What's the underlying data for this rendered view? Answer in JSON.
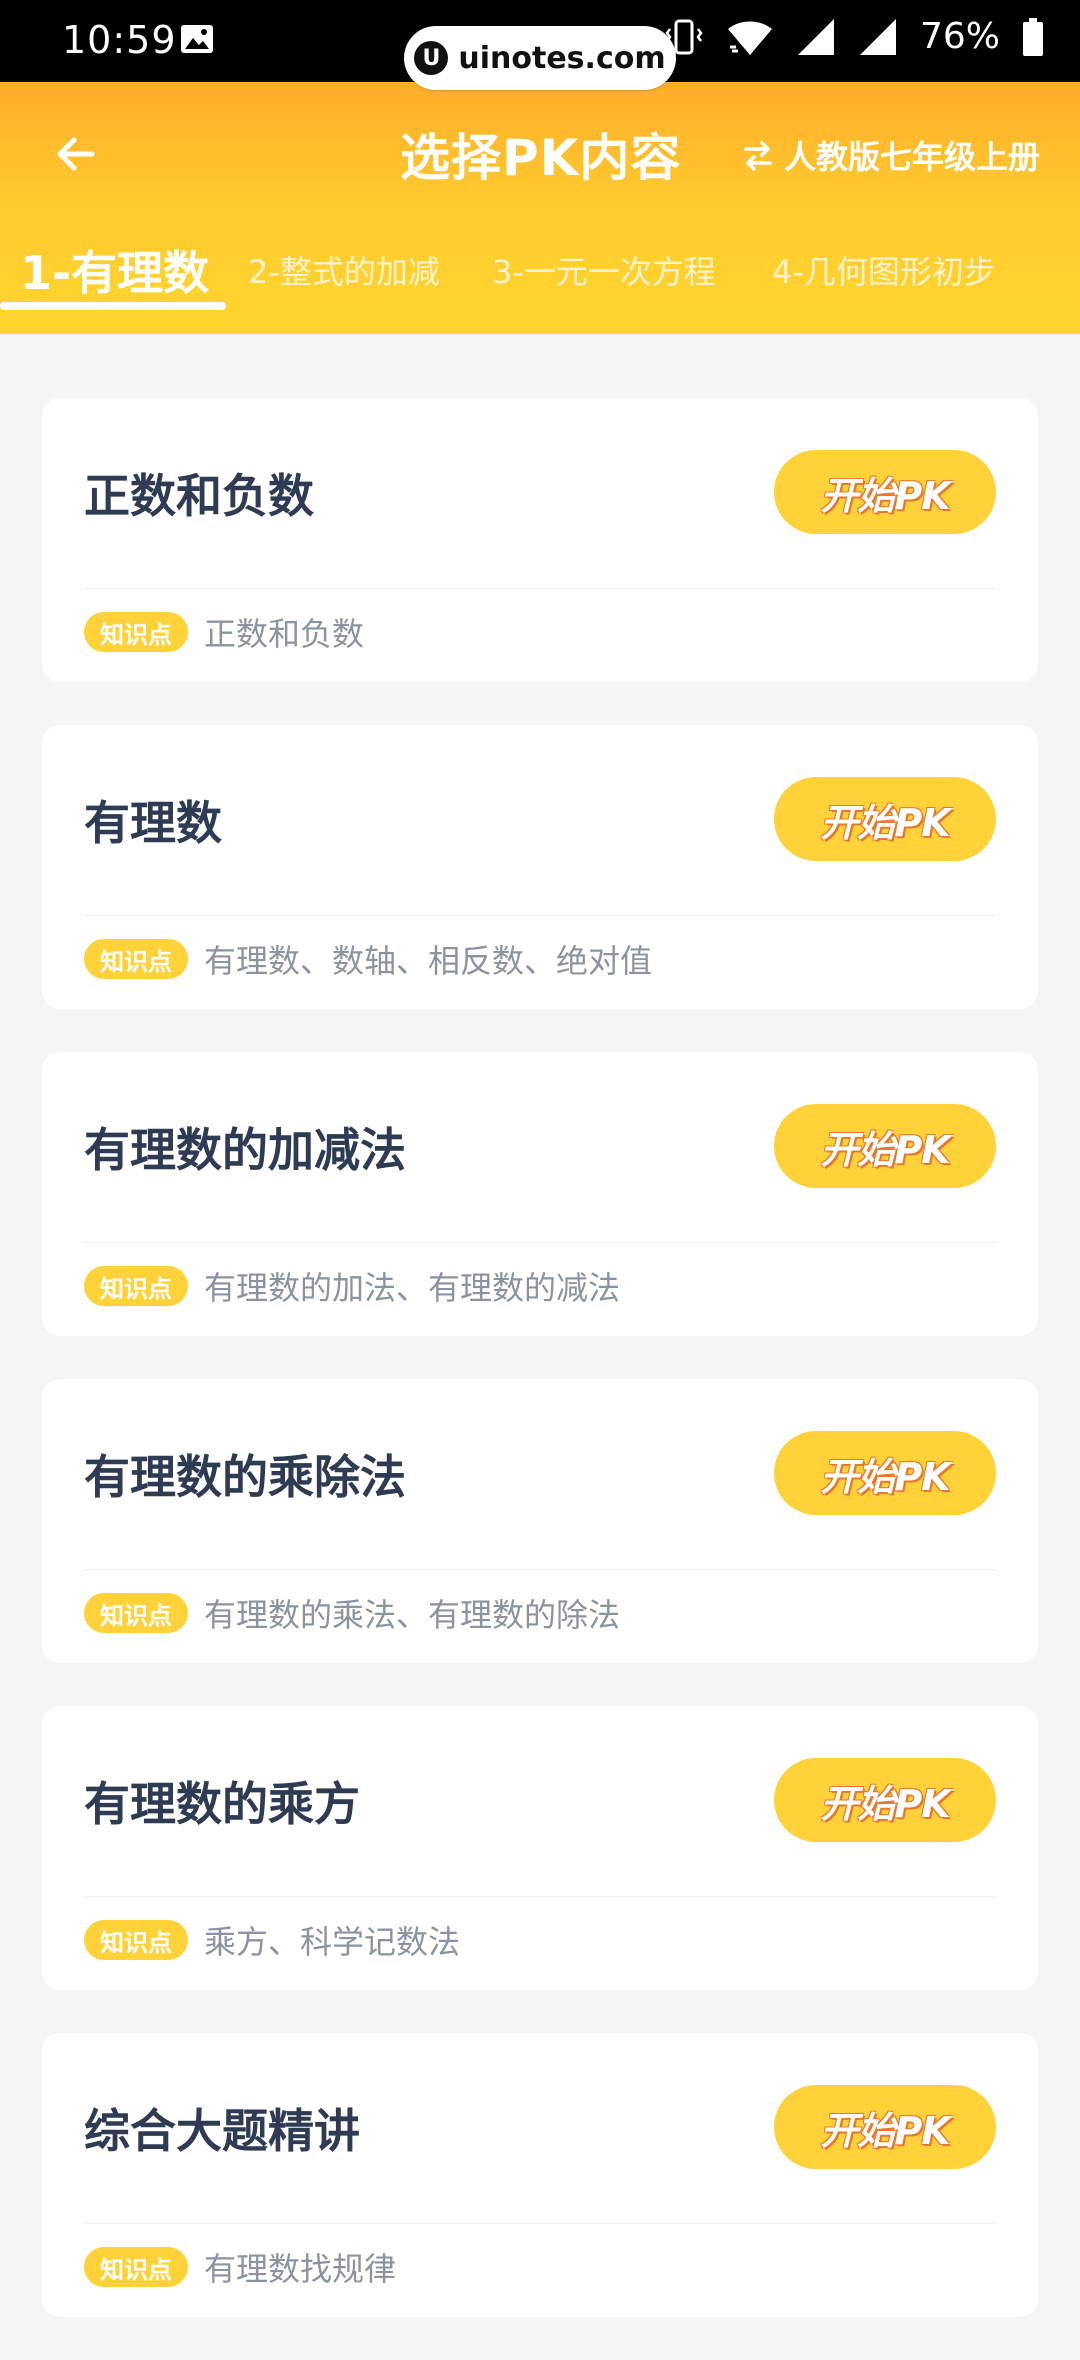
{
  "status_bar": {
    "time": "10:59",
    "battery": "76%",
    "icons": [
      "gallery-icon",
      "vibrate-icon",
      "wifi-icon",
      "signal-icon",
      "signal-icon",
      "battery-icon"
    ]
  },
  "watermark": {
    "text": "uinotes.com",
    "logo_letter": "U"
  },
  "header": {
    "title": "选择PK内容",
    "edition": "人教版七年级上册",
    "back_icon": "arrow-left-icon",
    "switch_icon": "swap-icon"
  },
  "tabs": [
    {
      "label": "1-有理数",
      "active": true
    },
    {
      "label": "2-整式的加减",
      "active": false
    },
    {
      "label": "3-一元一次方程",
      "active": false
    },
    {
      "label": "4-几何图形初步",
      "active": false
    }
  ],
  "cards": [
    {
      "title": "正数和负数",
      "button": "开始PK",
      "badge": "知识点",
      "points": "正数和负数"
    },
    {
      "title": "有理数",
      "button": "开始PK",
      "badge": "知识点",
      "points": "有理数、数轴、相反数、绝对值"
    },
    {
      "title": "有理数的加减法",
      "button": "开始PK",
      "badge": "知识点",
      "points": "有理数的加法、有理数的减法"
    },
    {
      "title": "有理数的乘除法",
      "button": "开始PK",
      "badge": "知识点",
      "points": "有理数的乘法、有理数的除法"
    },
    {
      "title": "有理数的乘方",
      "button": "开始PK",
      "badge": "知识点",
      "points": "乘方、科学记数法"
    },
    {
      "title": "综合大题精讲",
      "button": "开始PK",
      "badge": "知识点",
      "points": "有理数找规律"
    }
  ],
  "colors": {
    "accent": "#ffd23a",
    "header_top": "#ffac2a",
    "header_bottom": "#ffd62e",
    "title_text": "#2f3b52",
    "secondary_text": "#8b93a3",
    "background": "#f5f5f5"
  }
}
